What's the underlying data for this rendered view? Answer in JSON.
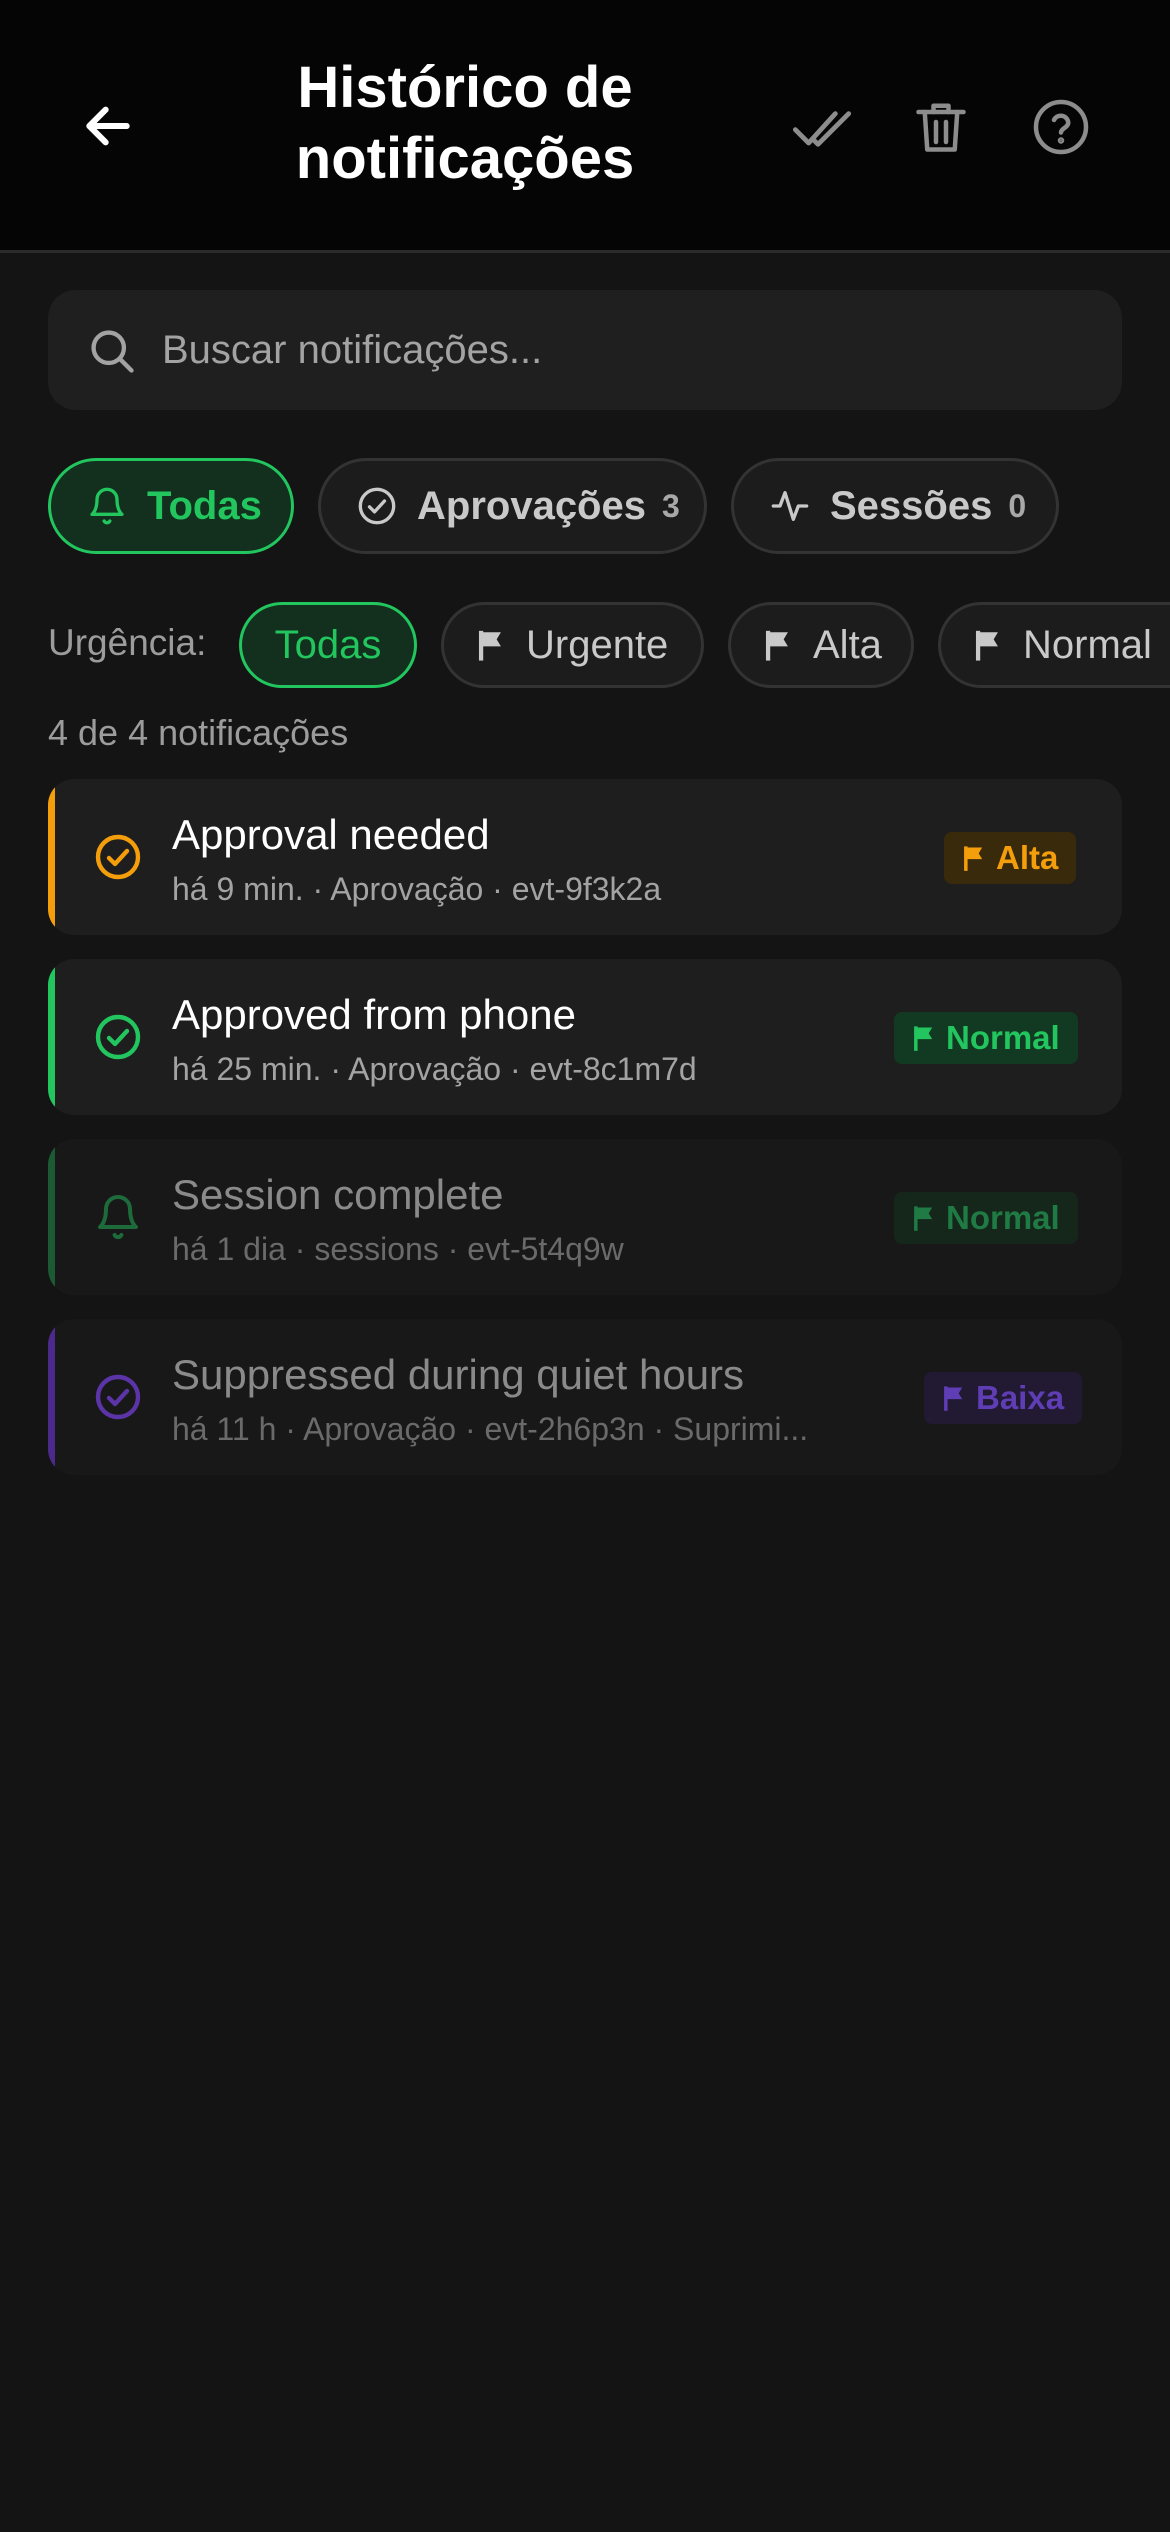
{
  "header": {
    "title": "Histórico de notificações",
    "back_icon": "arrow-left-icon",
    "mark_read_icon": "double-check-icon",
    "delete_icon": "trash-icon",
    "help_icon": "help-circle-icon"
  },
  "search": {
    "placeholder": "Buscar notificações...",
    "value": ""
  },
  "tabs": [
    {
      "label": "Todas",
      "icon": "bell-icon",
      "active": true
    },
    {
      "label": "Aprovações",
      "icon": "check-circle-icon",
      "count": "3"
    },
    {
      "label": "Sessões",
      "icon": "activity-icon",
      "count": "0"
    }
  ],
  "urgency": {
    "label": "Urgência:",
    "options": [
      {
        "label": "Todas",
        "active": true
      },
      {
        "label": "Urgente",
        "icon": "flag-icon"
      },
      {
        "label": "Alta",
        "icon": "flag-icon"
      },
      {
        "label": "Normal",
        "icon": "flag-icon"
      }
    ]
  },
  "count_text": "4 de 4 notificações",
  "notifications": [
    {
      "title": "Approval needed",
      "meta": "há 9 min. · Aprovação · evt-9f3k2a",
      "badge": "Alta",
      "color": "#f59e0b",
      "icon": "check-circle-icon"
    },
    {
      "title": "Approved from phone",
      "meta": "há 25 min. · Aprovação · evt-8c1m7d",
      "badge": "Normal",
      "color": "#22c55e",
      "icon": "check-circle-icon"
    },
    {
      "title": "Session complete",
      "meta": "há 1 dia · sessions · evt-5t4q9w",
      "badge": "Normal",
      "color": "#22c55e",
      "icon": "bell-icon"
    },
    {
      "title": "Suppressed during quiet hours",
      "meta": "há 11 h · Aprovação · evt-2h6p3n · Suprimi...",
      "badge": "Baixa",
      "color": "#7c3aed",
      "icon": "check-circle-icon"
    }
  ]
}
